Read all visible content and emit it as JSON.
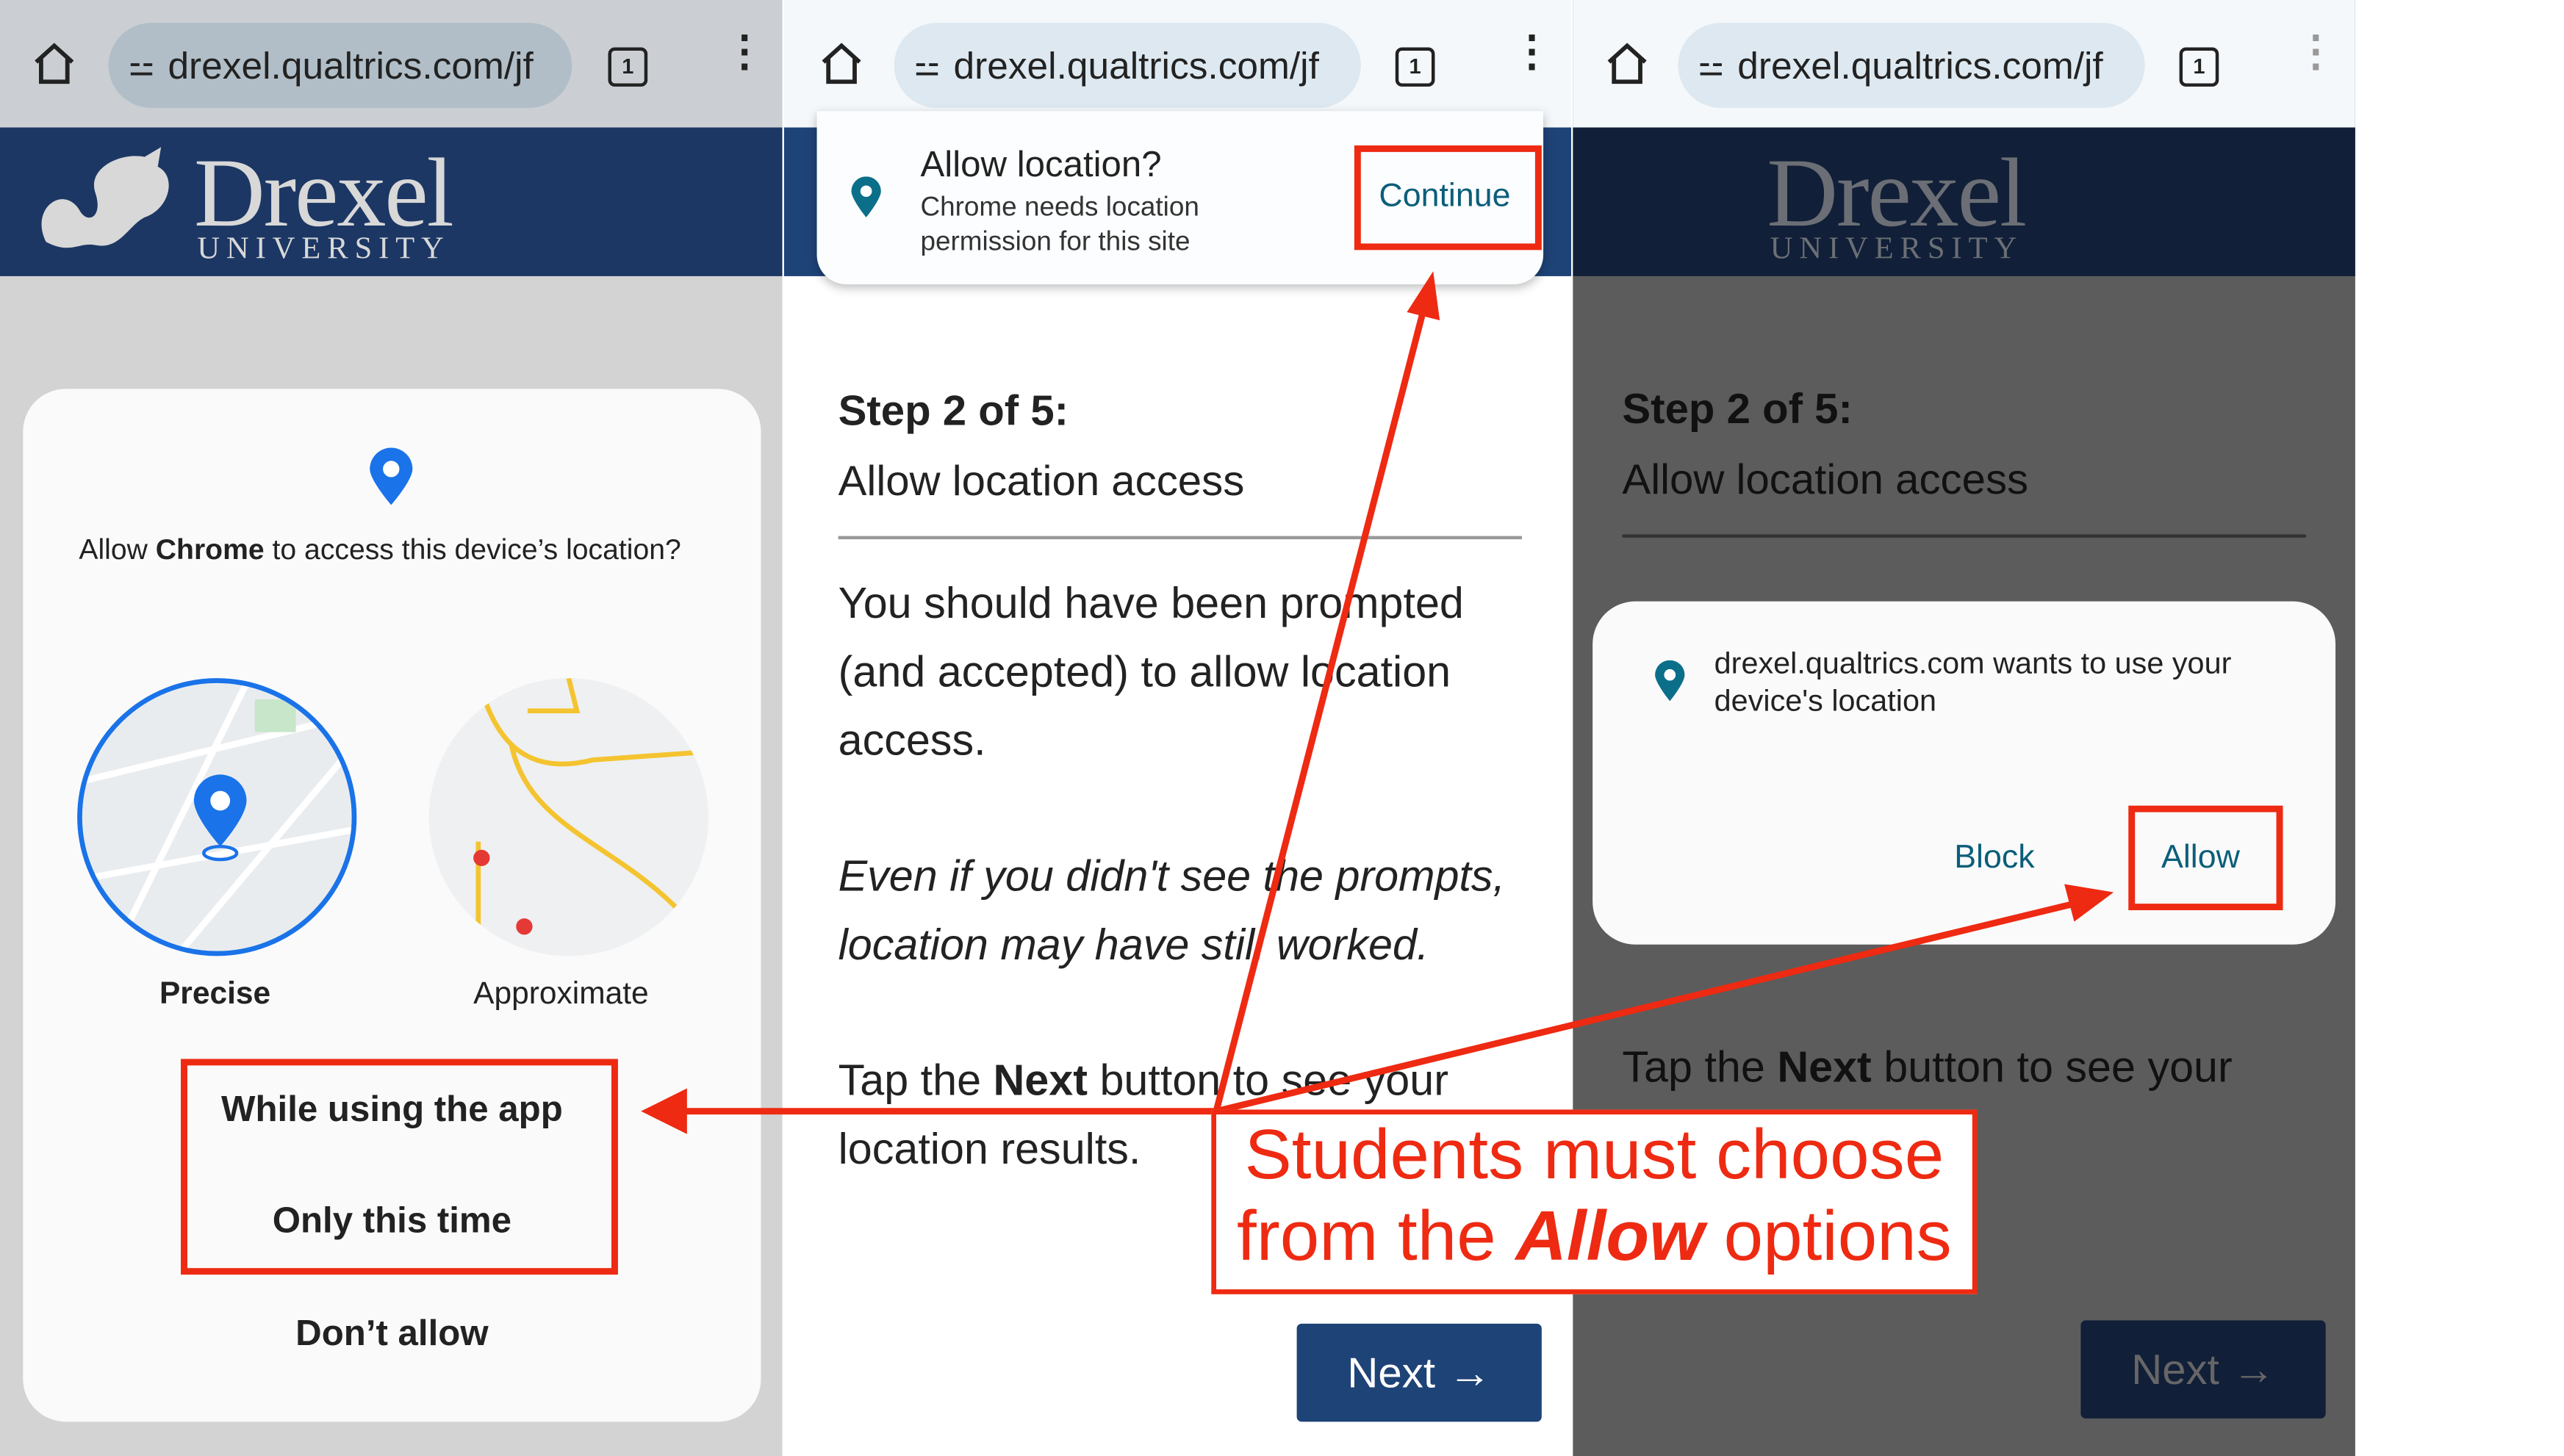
{
  "browser": {
    "url": "drexel.qualtrics.com/jf",
    "tab_count": "1"
  },
  "logo": {
    "name": "Drexel",
    "sub": "UNIVERSITY"
  },
  "android_dialog": {
    "prompt_pre": "Allow ",
    "prompt_app": "Chrome",
    "prompt_post": " to access this device’s location?",
    "precise": "Precise",
    "approximate": "Approximate",
    "options": [
      "While using the app",
      "Only this time",
      "Don’t allow"
    ]
  },
  "chrome_prompt": {
    "title": "Allow location?",
    "body_line1": "Chrome needs location",
    "body_line2": "permission for this site",
    "continue": "Continue"
  },
  "survey": {
    "step": "Step 2 of 5:",
    "heading": "Allow location access",
    "p1": [
      "You should have been prompted",
      "(and accepted) to allow location",
      "access."
    ],
    "p2": [
      "Even if you didn't see the prompts,",
      "location may have still worked."
    ],
    "p3_pre": "Tap the ",
    "p3_bold": "Next",
    "p3_post": " button to see your",
    "p3_line2": "location results.",
    "next": "Next"
  },
  "site_prompt": {
    "line1": "drexel.qualtrics.com wants to use your",
    "line2": "device's location",
    "block": "Block",
    "allow": "Allow"
  },
  "annotation": {
    "line1": "Students must choose",
    "line2_pre": "from the ",
    "line2_em": "Allow",
    "line2_post": " options"
  },
  "colors": {
    "annotation_red": "#ee2a12",
    "drexel_navy": "#1c3764",
    "link_teal": "#0b5e7a",
    "pin_blue": "#1a73e8"
  }
}
